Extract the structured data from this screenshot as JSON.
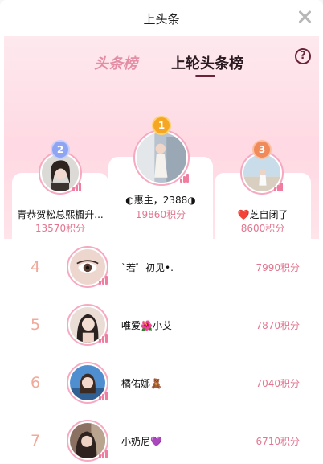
{
  "dialog": {
    "title": "上头条"
  },
  "tabs": {
    "leaderboard": "头条榜",
    "last_round": "上轮头条榜"
  },
  "help_label": "?",
  "podium": [
    {
      "rank": "1",
      "name": "◐惠主，2388◑",
      "points": "19860积分"
    },
    {
      "rank": "2",
      "name": "青恭贺松总熙楓升...",
      "points": "13570积分"
    },
    {
      "rank": "3",
      "name": "❤️芝自闭了",
      "points": "8600积分"
    }
  ],
  "list": [
    {
      "rank": "4",
      "name": "`若゜初见•.",
      "points": "7990积分"
    },
    {
      "rank": "5",
      "name": "唯爱🌺小艾",
      "points": "7870积分"
    },
    {
      "rank": "6",
      "name": "橘佑娜🧸",
      "points": "7040积分"
    },
    {
      "rank": "7",
      "name": "小奶尼💜",
      "points": "6710积分"
    }
  ],
  "colors": {
    "accent": "#e2768f",
    "rank_text": "#f0a99a",
    "hero_bg": "#ffd9e3"
  }
}
